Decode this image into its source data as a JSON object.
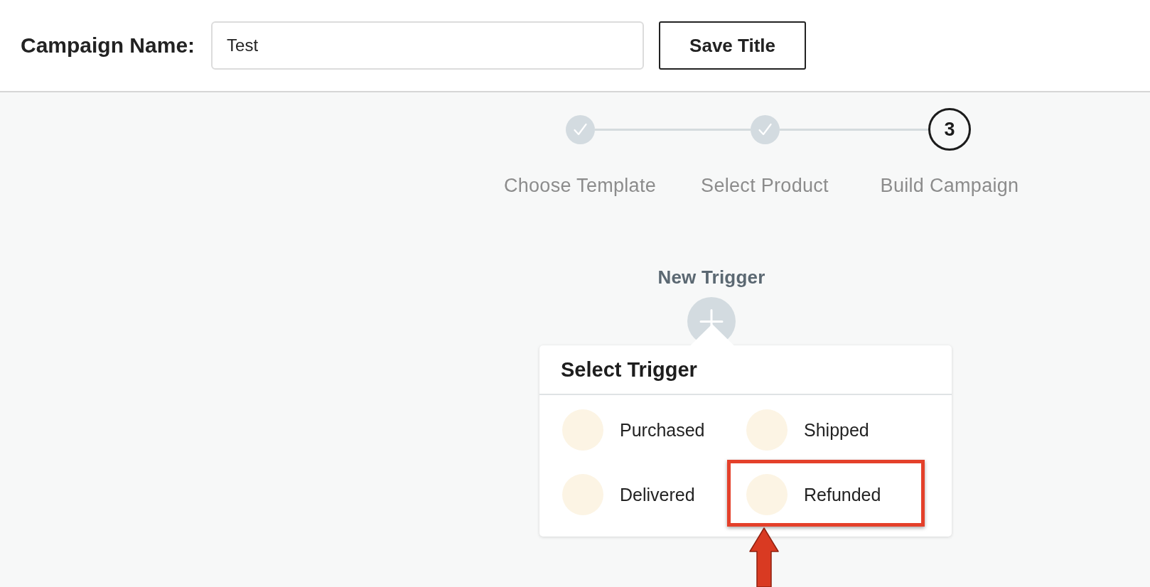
{
  "header": {
    "label": "Campaign Name:",
    "name_input": {
      "value": "Test"
    },
    "save_button": "Save Title"
  },
  "stepper": {
    "steps": [
      {
        "label": "Choose Template",
        "done": true
      },
      {
        "label": "Select Product",
        "done": true
      },
      {
        "label": "Build Campaign",
        "done": false,
        "number": "3"
      }
    ]
  },
  "new_trigger": {
    "label": "New Trigger"
  },
  "select_trigger": {
    "title": "Select Trigger",
    "options": [
      {
        "label": "Purchased",
        "highlighted": false
      },
      {
        "label": "Shipped",
        "highlighted": false
      },
      {
        "label": "Delivered",
        "highlighted": false
      },
      {
        "label": "Refunded",
        "highlighted": true
      }
    ]
  }
}
